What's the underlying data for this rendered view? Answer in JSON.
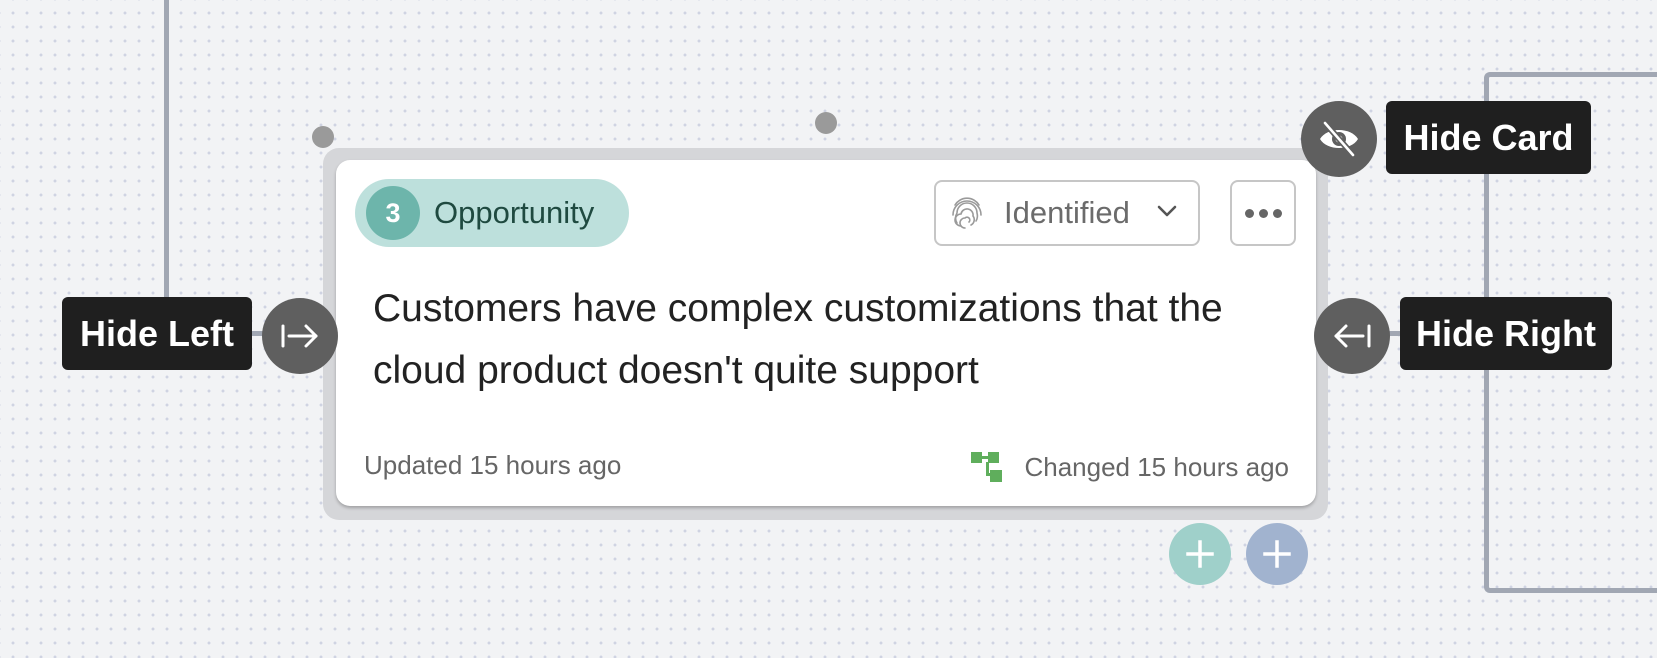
{
  "card": {
    "badge_number": "3",
    "type_label": "Opportunity",
    "status": {
      "selected": "Identified",
      "icon": "fingerprint-icon"
    },
    "more_icon": "ellipsis-icon",
    "title": "Customers have complex customizations that the cloud product doesn't quite support",
    "updated_text": "Updated 15 hours ago",
    "changed_text": "Changed 15 hours ago",
    "changed_icon": "hierarchy-icon"
  },
  "tooltips": {
    "hide_card": "Hide Card",
    "hide_left": "Hide Left",
    "hide_right": "Hide Right"
  },
  "add_buttons": [
    {
      "name": "add-teal-button",
      "color": "#9fd0ca"
    },
    {
      "name": "add-blue-button",
      "color": "#a1b3cf"
    }
  ],
  "colors": {
    "pill_bg": "#bde0dc",
    "badge_bg": "#6db5ab",
    "pill_text": "#1f4a40",
    "changed_icon": "#5fae5c",
    "connector": "#a1a7b3",
    "tooltip_bg": "#1f1f1f"
  }
}
